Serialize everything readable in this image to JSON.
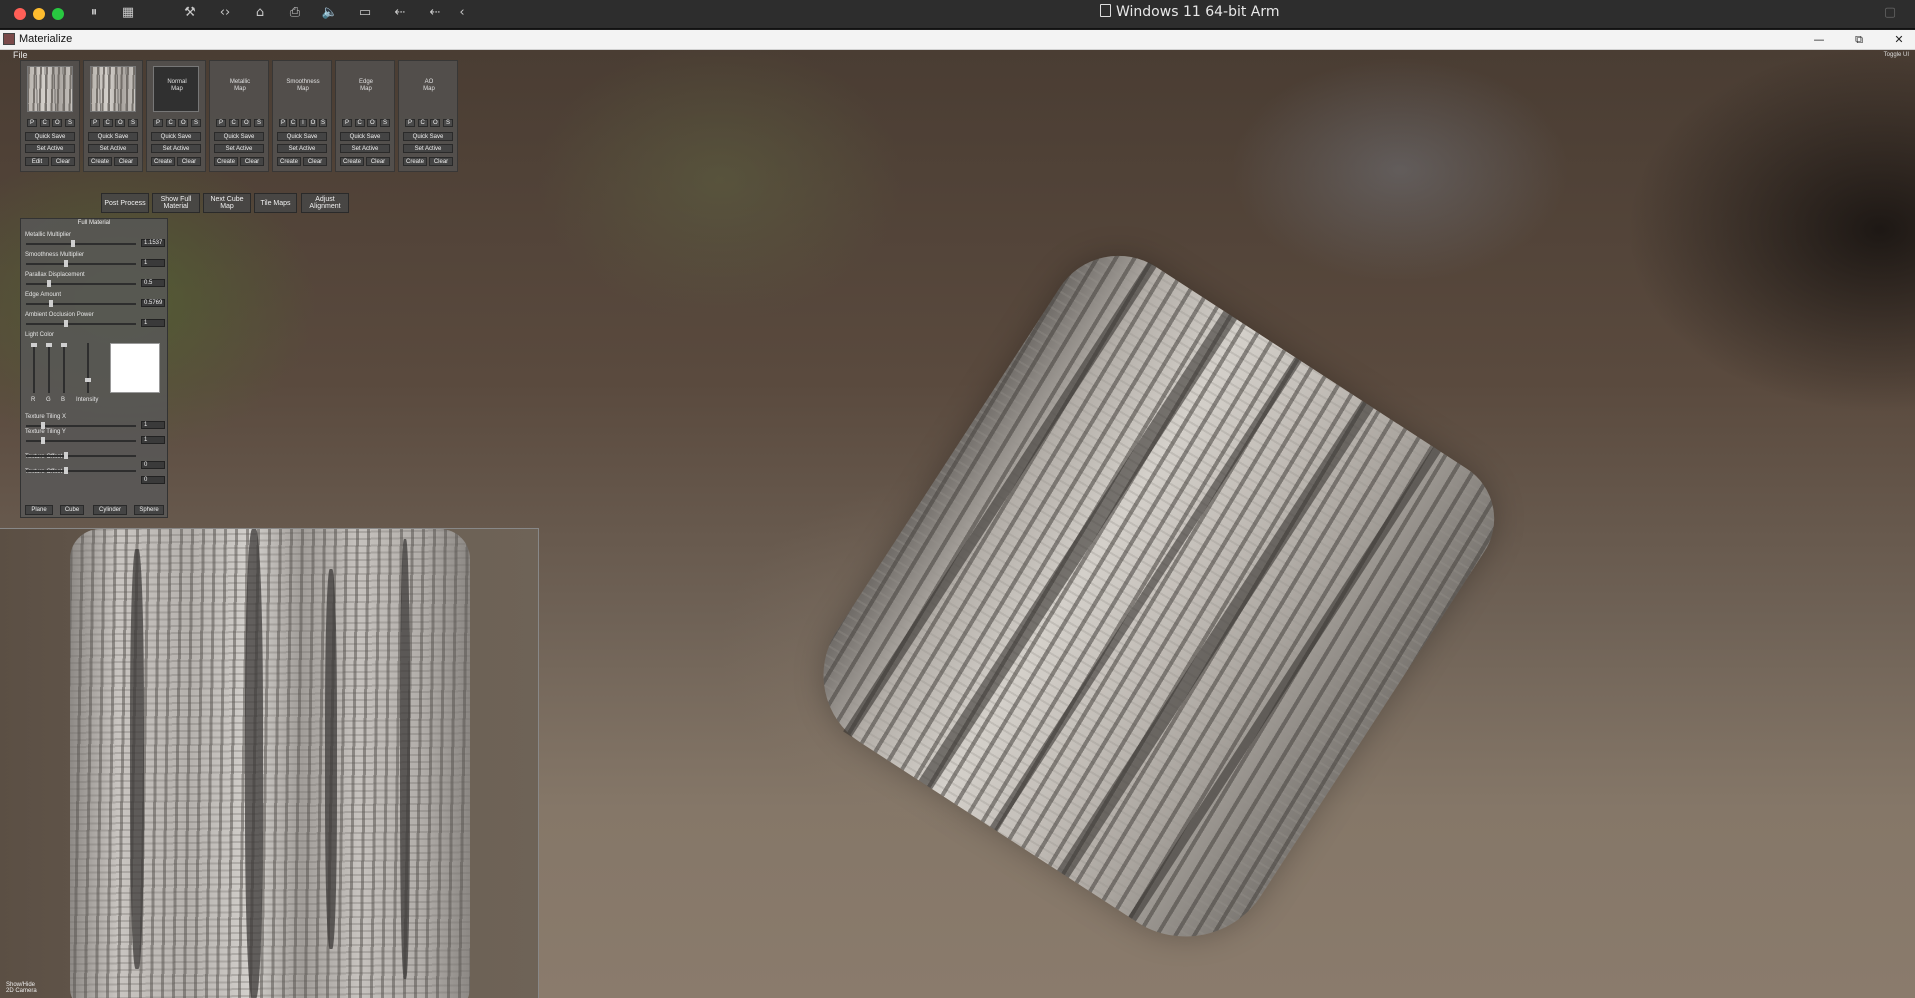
{
  "host": {
    "vm_title": "Windows 11 64-bit Arm",
    "traffic_lights": {
      "close": "#ff5f57",
      "minimize": "#febc2e",
      "zoom": "#28c840"
    }
  },
  "window": {
    "app_title": "Materialize",
    "minimize_glyph": "—",
    "restore_glyph": "⧉",
    "close_glyph": "✕"
  },
  "menu": {
    "file": "File",
    "toggle_ui": "Toggle UI"
  },
  "slots": [
    {
      "id": "diffuse",
      "label": "",
      "thumb": "bark",
      "pcos": [
        "P",
        "C",
        "O",
        "S"
      ],
      "quick_save": "Quick Save",
      "set_active": "Set Active",
      "left_btn": "Edit",
      "right_btn": "Clear"
    },
    {
      "id": "height",
      "label": "",
      "thumb": "bark",
      "pcos": [
        "P",
        "C",
        "O",
        "S"
      ],
      "quick_save": "Quick Save",
      "set_active": "Set Active",
      "left_btn": "Create",
      "right_btn": "Clear"
    },
    {
      "id": "normal",
      "label": "Normal\nMap",
      "thumb": "normal",
      "pcos": [
        "P",
        "C",
        "O",
        "S"
      ],
      "quick_save": "Quick Save",
      "set_active": "Set Active",
      "left_btn": "Create",
      "right_btn": "Clear"
    },
    {
      "id": "metallic",
      "label": "Metallic\nMap",
      "thumb": "",
      "pcos": [
        "P",
        "C",
        "O",
        "S"
      ],
      "quick_save": "Quick Save",
      "set_active": "Set Active",
      "left_btn": "Create",
      "right_btn": "Clear"
    },
    {
      "id": "smoothness",
      "label": "Smoothness\nMap",
      "thumb": "",
      "pcos": [
        "P",
        "C",
        "I",
        "O",
        "S"
      ],
      "quick_save": "Quick Save",
      "set_active": "Set Active",
      "left_btn": "Create",
      "right_btn": "Clear"
    },
    {
      "id": "edge",
      "label": "Edge\nMap",
      "thumb": "",
      "pcos": [
        "P",
        "C",
        "O",
        "S"
      ],
      "quick_save": "Quick Save",
      "set_active": "Set Active",
      "left_btn": "Create",
      "right_btn": "Clear"
    },
    {
      "id": "ao",
      "label": "AO\nMap",
      "thumb": "",
      "pcos": [
        "P",
        "C",
        "O",
        "S"
      ],
      "quick_save": "Quick Save",
      "set_active": "Set Active",
      "left_btn": "Create",
      "right_btn": "Clear"
    }
  ],
  "actions": {
    "post_process": "Post Process",
    "show_full_material": "Show Full Material",
    "next_cube_map": "Next Cube Map",
    "tile_maps": "Tile Maps",
    "adjust_alignment": "Adjust Alignment"
  },
  "panel": {
    "title": "Full Material",
    "sliders": [
      {
        "label": "Metallic Multiplier",
        "value": "1.1537",
        "fraction": 0.42
      },
      {
        "label": "Smoothness Multiplier",
        "value": "1",
        "fraction": 0.36
      },
      {
        "label": "Parallax Displacement",
        "value": "0.5",
        "fraction": 0.2
      },
      {
        "label": "Edge Amount",
        "value": "0.5769",
        "fraction": 0.22
      },
      {
        "label": "Ambient Occlusion Power",
        "value": "1",
        "fraction": 0.36
      }
    ],
    "light_color": {
      "label": "Light Color",
      "r_label": "R",
      "g_label": "G",
      "b_label": "B",
      "intensity_label": "Intensity",
      "swatch": "#ffffff"
    },
    "tiling": [
      {
        "label": "Texture Tiling X",
        "value": "1",
        "fraction": 0.14
      },
      {
        "label": "Texture Tiling Y",
        "value": "1",
        "fraction": 0.14
      },
      {
        "label": "Texture Offset X",
        "value": "0",
        "fraction": 0.36
      },
      {
        "label": "Texture Offset Y",
        "value": "0",
        "fraction": 0.36
      }
    ],
    "shapes": {
      "plane": "Plane",
      "cube": "Cube",
      "cylinder": "Cylinder",
      "sphere": "Sphere"
    }
  },
  "preview": {
    "show_hide": "Show/Hide\n2D Camera"
  }
}
